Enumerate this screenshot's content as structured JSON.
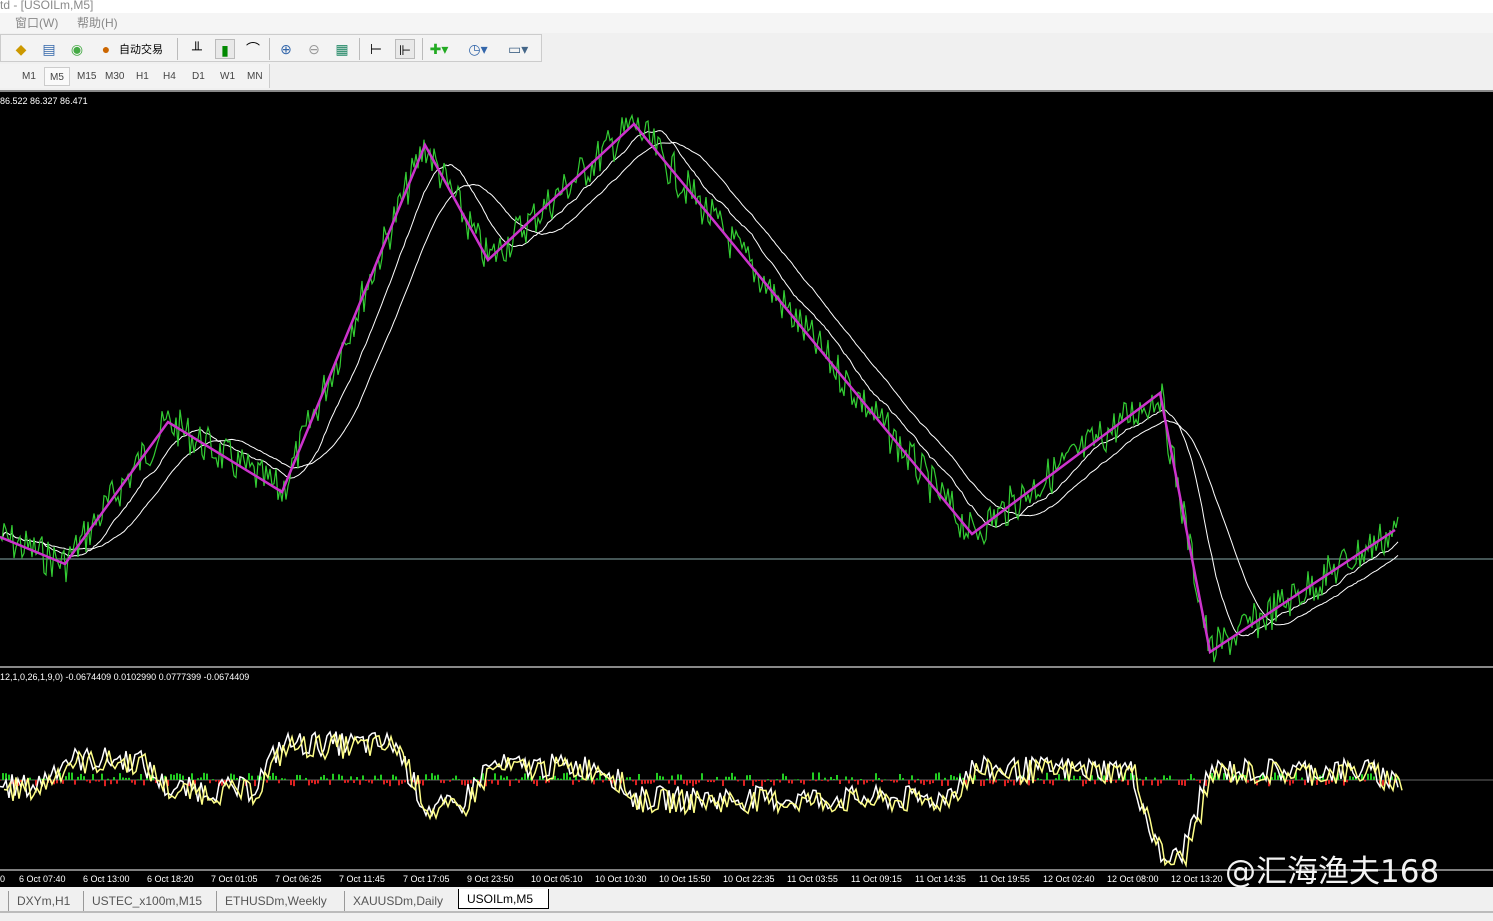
{
  "window": {
    "title": "td - [USOILm,M5]"
  },
  "menu": [
    {
      "label": "窗口(W)"
    },
    {
      "label": "帮助(H)"
    }
  ],
  "toolbar": {
    "auto_trade_label": "自动交易",
    "icons": [
      "profile-icon",
      "market-watch-icon",
      "data-window-icon",
      "navigator-icon",
      "auto-trade-icon",
      "bar-chart-icon",
      "candlestick-icon",
      "line-chart-icon",
      "zoom-in-icon",
      "zoom-out-icon",
      "tile-windows-icon",
      "auto-scroll-icon",
      "chart-shift-icon",
      "indicators-icon",
      "periods-icon",
      "templates-icon"
    ]
  },
  "timeframes": [
    {
      "label": "M1"
    },
    {
      "label": "M5",
      "active": true
    },
    {
      "label": "M15"
    },
    {
      "label": "M30"
    },
    {
      "label": "H1"
    },
    {
      "label": "H4"
    },
    {
      "label": "D1"
    },
    {
      "label": "W1"
    },
    {
      "label": "MN"
    }
  ],
  "chart": {
    "ohlc_text": "86.522 86.327 86.471",
    "indicator_text": "12,1,0,26,1,9,0) -0.0674409 0.0102990 0.0777399 -0.0674409",
    "colors": {
      "price": "#33cc33",
      "zigzag": "#cc33cc",
      "ma": "#ffffff",
      "hist_up": "#22cc22",
      "hist_down": "#dd2222",
      "signal": "#ffff88"
    },
    "time_labels": [
      "0",
      "6 Oct 07:40",
      "6 Oct 13:00",
      "6 Oct 18:20",
      "7 Oct 01:05",
      "7 Oct 06:25",
      "7 Oct 11:45",
      "7 Oct 17:05",
      "9 Oct 23:50",
      "10 Oct 05:10",
      "10 Oct 10:30",
      "10 Oct 15:50",
      "10 Oct 22:35",
      "11 Oct 03:55",
      "11 Oct 09:15",
      "11 Oct 14:35",
      "11 Oct 19:55",
      "12 Oct 02:40",
      "12 Oct 08:00",
      "12 Oct 13:20"
    ]
  },
  "tabs": [
    {
      "label": "DXYm,H1"
    },
    {
      "label": "USTEC_x100m,M15"
    },
    {
      "label": "ETHUSDm,Weekly"
    },
    {
      "label": "XAUUSDm,Daily"
    },
    {
      "label": "USOILm,M5",
      "active": true
    }
  ],
  "watermark": "@汇海渔夫168"
}
